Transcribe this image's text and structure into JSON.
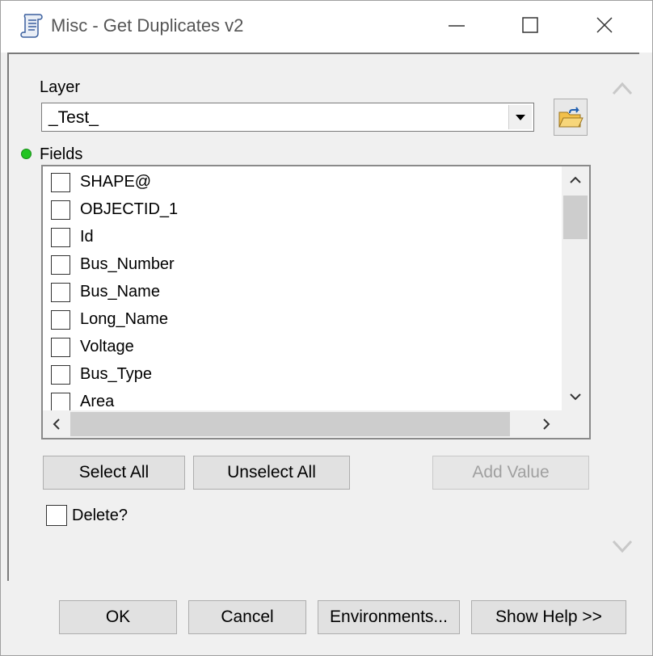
{
  "window": {
    "title": "Misc - Get Duplicates v2",
    "icon": "script-scroll-icon"
  },
  "titlebar_buttons": {
    "minimize": "minimize-icon",
    "maximize": "maximize-icon",
    "close": "close-icon"
  },
  "layer": {
    "label": "Layer",
    "value": "_Test_"
  },
  "fields": {
    "label": "Fields",
    "required_indicator_color": "#22c422",
    "items": [
      {
        "label": "SHAPE@",
        "checked": false
      },
      {
        "label": "OBJECTID_1",
        "checked": false
      },
      {
        "label": "Id",
        "checked": false
      },
      {
        "label": "Bus_Number",
        "checked": false
      },
      {
        "label": "Bus_Name",
        "checked": false
      },
      {
        "label": "Long_Name",
        "checked": false
      },
      {
        "label": "Voltage",
        "checked": false
      },
      {
        "label": "Bus_Type",
        "checked": false
      },
      {
        "label": "Area",
        "checked": false
      }
    ]
  },
  "list_buttons": {
    "select_all": "Select All",
    "unselect_all": "Unselect All",
    "add_value": "Add Value"
  },
  "delete": {
    "label": "Delete?",
    "checked": false
  },
  "footer_buttons": {
    "ok": "OK",
    "cancel": "Cancel",
    "environments": "Environments...",
    "show_help": "Show Help >>"
  }
}
